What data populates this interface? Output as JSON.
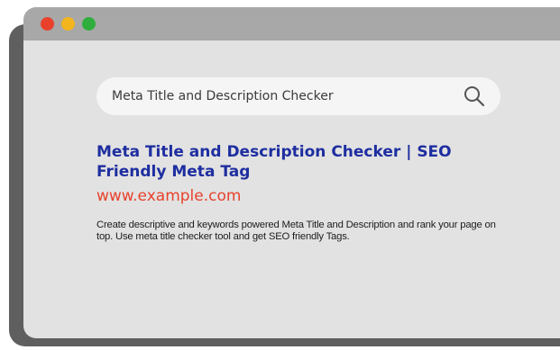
{
  "window": {
    "controls": [
      "close",
      "minimize",
      "maximize"
    ],
    "control_colors": {
      "close": "#e8412c",
      "minimize": "#f3b51e",
      "maximize": "#2fae3d"
    }
  },
  "search": {
    "value": "Meta Title and Description Checker",
    "icon": "search-icon"
  },
  "result": {
    "title": "Meta Title and Description Checker | SEO Friendly Meta Tag",
    "url": "www.example.com",
    "description": "Create descriptive and keywords powered Meta Title and Description and rank your page on top. Use meta title checker tool and get SEO friendly Tags.",
    "colors": {
      "title": "#1e2ea0",
      "url": "#e8422c"
    }
  }
}
